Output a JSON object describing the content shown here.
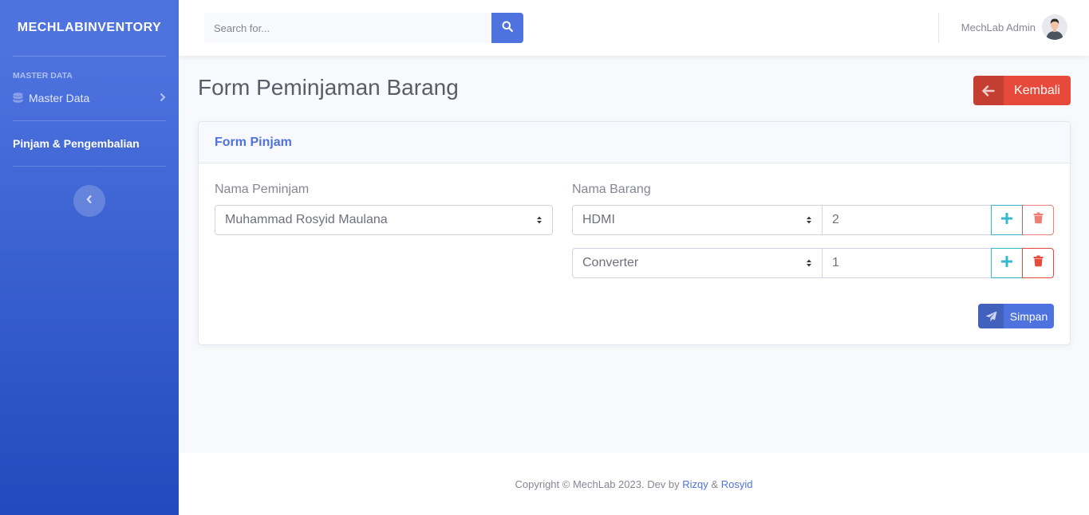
{
  "sidebar": {
    "brand": "MECHLABINVENTORY",
    "heading": "MASTER DATA",
    "items": [
      {
        "label": "Master Data",
        "icon": "database-icon"
      },
      {
        "label": "Pinjam & Pengembalian"
      }
    ]
  },
  "topbar": {
    "search_placeholder": "Search for...",
    "user_name": "MechLab Admin"
  },
  "page": {
    "title": "Form Peminjaman Barang",
    "back_label": "Kembali"
  },
  "card": {
    "title": "Form Pinjam",
    "borrower_label": "Nama Peminjam",
    "borrower_value": "Muhammad Rosyid Maulana",
    "item_label": "Nama Barang",
    "rows": [
      {
        "item": "HDMI",
        "qty": "2"
      },
      {
        "item": "Converter",
        "qty": "1"
      }
    ],
    "save_label": "Simpan"
  },
  "footer": {
    "text": "Copyright © MechLab 2023. Dev by",
    "author1": "Rizqy",
    "amp": "&",
    "author2": "Rosyid"
  },
  "colors": {
    "primary": "#4e73df",
    "danger": "#e74a3b",
    "info": "#36b9cc"
  }
}
